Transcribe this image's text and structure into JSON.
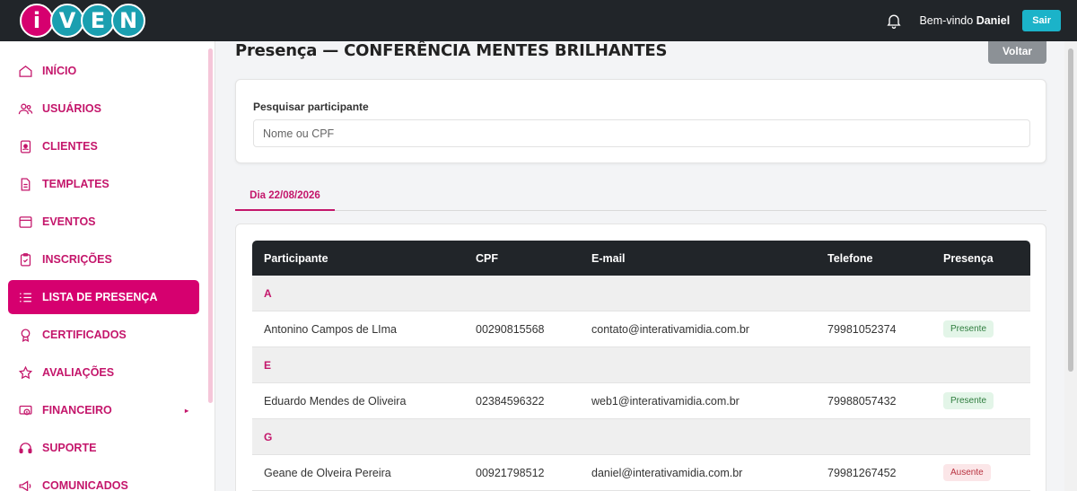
{
  "brand": {
    "logo_text": "iVEN",
    "letters": [
      "i",
      "V",
      "E",
      "N"
    ]
  },
  "header": {
    "welcome_prefix": "Bem-vindo",
    "user_name": "Daniel",
    "logout_label": "Sair"
  },
  "sidebar": {
    "items": [
      {
        "label": "INÍCIO",
        "icon": "home-icon"
      },
      {
        "label": "USUÁRIOS",
        "icon": "users-icon"
      },
      {
        "label": "CLIENTES",
        "icon": "client-badge-icon"
      },
      {
        "label": "TEMPLATES",
        "icon": "document-icon"
      },
      {
        "label": "EVENTOS",
        "icon": "calendar-window-icon"
      },
      {
        "label": "INSCRIÇÕES",
        "icon": "clipboard-icon"
      },
      {
        "label": "LISTA DE PRESENÇA",
        "icon": "list-icon",
        "active": true
      },
      {
        "label": "CERTIFICADOS",
        "icon": "award-icon"
      },
      {
        "label": "AVALIAÇÕES",
        "icon": "star-icon"
      },
      {
        "label": "FINANCEIRO",
        "icon": "money-icon",
        "submenu_caret": "▸"
      },
      {
        "label": "SUPORTE",
        "icon": "headset-icon"
      },
      {
        "label": "COMUNICADOS",
        "icon": "megaphone-icon"
      }
    ]
  },
  "page": {
    "title": "Presença — CONFERÊNCIA MENTES BRILHANTES",
    "back_label": "Voltar"
  },
  "search": {
    "label": "Pesquisar participante",
    "placeholder": "Nome ou CPF",
    "value": ""
  },
  "tabs": [
    {
      "label": "Dia 22/08/2026",
      "active": true
    }
  ],
  "table": {
    "columns": [
      "Participante",
      "CPF",
      "E-mail",
      "Telefone",
      "Presença"
    ],
    "groups": [
      {
        "letter": "A",
        "rows": [
          {
            "name": "Antonino Campos de LIma",
            "cpf": "00290815568",
            "email": "contato@interativamidia.com.br",
            "phone": "79981052374",
            "status": "Presente",
            "status_type": "presente"
          }
        ]
      },
      {
        "letter": "E",
        "rows": [
          {
            "name": "Eduardo Mendes de Oliveira",
            "cpf": "02384596322",
            "email": "web1@interativamidia.com.br",
            "phone": "79988057432",
            "status": "Presente",
            "status_type": "presente"
          }
        ]
      },
      {
        "letter": "G",
        "rows": [
          {
            "name": "Geane de Olveira Pereira",
            "cpf": "00921798512",
            "email": "daniel@interativamidia.com.br",
            "phone": "79981267452",
            "status": "Ausente",
            "status_type": "ausente"
          }
        ]
      }
    ]
  },
  "colors": {
    "brand_pink": "#d6006f",
    "brand_teal": "#1a9fb0",
    "topbar_dark": "#212529",
    "logout_teal": "#1bb3c9",
    "back_gray": "#8c9196"
  }
}
